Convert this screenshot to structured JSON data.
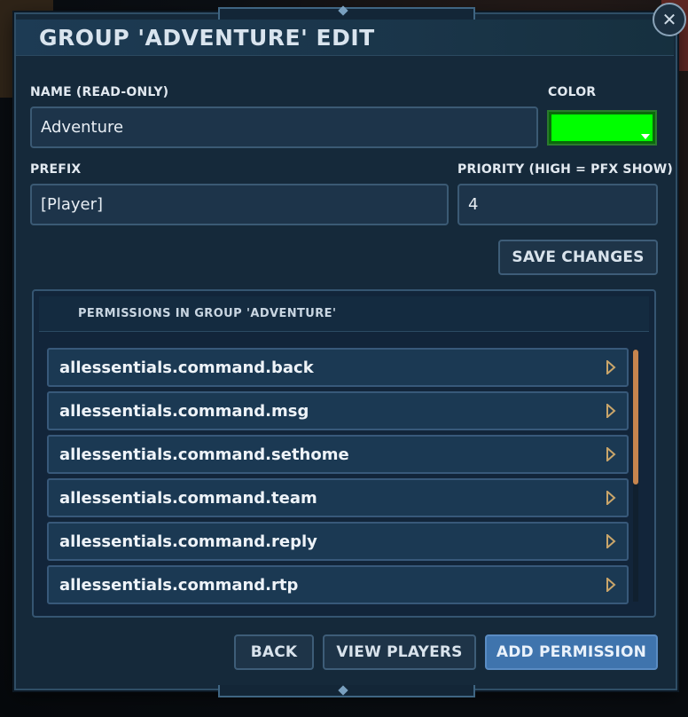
{
  "dialog": {
    "title": "GROUP 'ADVENTURE' EDIT",
    "close_icon": "close-icon"
  },
  "form": {
    "name_label": "NAME (READ-ONLY)",
    "name_value": "Adventure",
    "color_label": "COLOR",
    "color_value": "#00ff00",
    "prefix_label": "PREFIX",
    "prefix_value": "[Player]",
    "priority_label": "PRIORITY (HIGH = PFX SHOW)",
    "priority_value": "4",
    "save_label": "SAVE CHANGES"
  },
  "permissions": {
    "header": "PERMISSIONS IN GROUP 'ADVENTURE'",
    "items": [
      {
        "label": "allessentials.command.back"
      },
      {
        "label": "allessentials.command.msg"
      },
      {
        "label": "allessentials.command.sethome"
      },
      {
        "label": "allessentials.command.team"
      },
      {
        "label": "allessentials.command.reply"
      },
      {
        "label": "allessentials.command.rtp"
      }
    ]
  },
  "footer": {
    "back_label": "BACK",
    "view_players_label": "VIEW PLAYERS",
    "add_permission_label": "ADD PERMISSION"
  },
  "colors": {
    "accent": "#3f74ad",
    "scroll_thumb": "#c6854e",
    "arrow": "#c9a56a"
  }
}
